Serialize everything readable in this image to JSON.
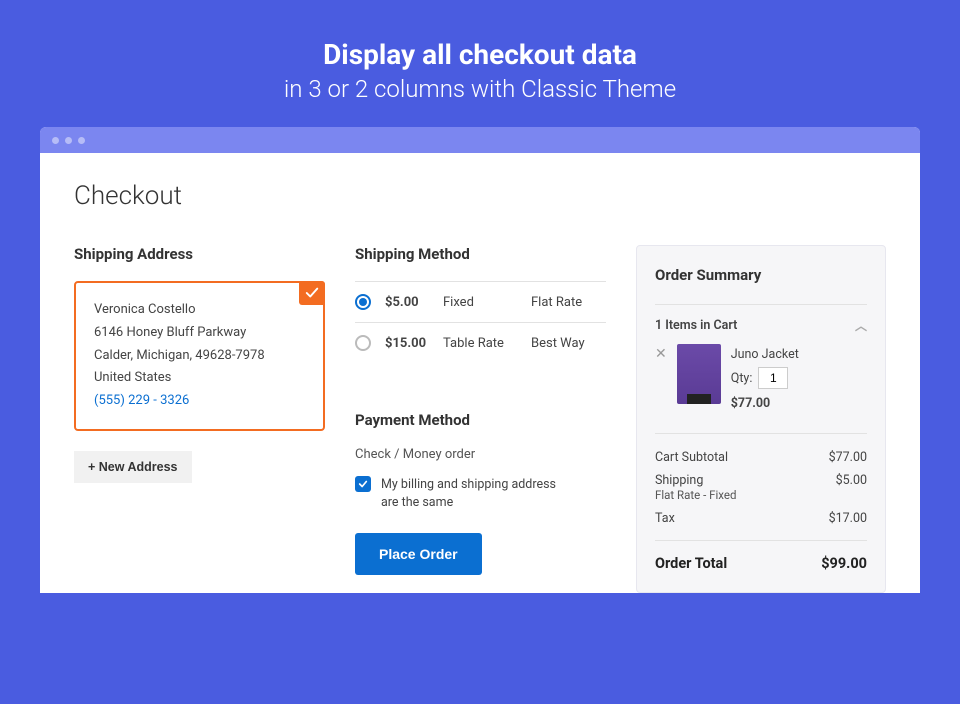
{
  "hero": {
    "title": "Display all checkout data",
    "subtitle": "in 3 or 2 columns with Classic Theme"
  },
  "page_title": "Checkout",
  "shipping_address": {
    "title": "Shipping Address",
    "name": "Veronica Costello",
    "street": "6146 Honey Bluff Parkway",
    "city_line": "Calder, Michigan, 49628-7978",
    "country": "United States",
    "phone": "(555) 229 - 3326",
    "new_btn": "+ New Address"
  },
  "shipping_method": {
    "title": "Shipping Method",
    "options": [
      {
        "price": "$5.00",
        "type": "Fixed",
        "carrier": "Flat Rate",
        "selected": true
      },
      {
        "price": "$15.00",
        "type": "Table Rate",
        "carrier": "Best Way",
        "selected": false
      }
    ]
  },
  "payment": {
    "title": "Payment Method",
    "type": "Check / Money order",
    "same_address": "My billing and shipping address are the same",
    "place_btn": "Place Order"
  },
  "summary": {
    "title": "Order Summary",
    "items_header": "1 Items in Cart",
    "item": {
      "name": "Juno Jacket",
      "qty_label": "Qty:",
      "qty": "1",
      "price": "$77.00"
    },
    "rows": {
      "subtotal_label": "Cart Subtotal",
      "subtotal": "$77.00",
      "shipping_label": "Shipping",
      "shipping_sub": "Flat Rate - Fixed",
      "shipping": "$5.00",
      "tax_label": "Tax",
      "tax": "$17.00"
    },
    "total_label": "Order Total",
    "total": "$99.00"
  }
}
